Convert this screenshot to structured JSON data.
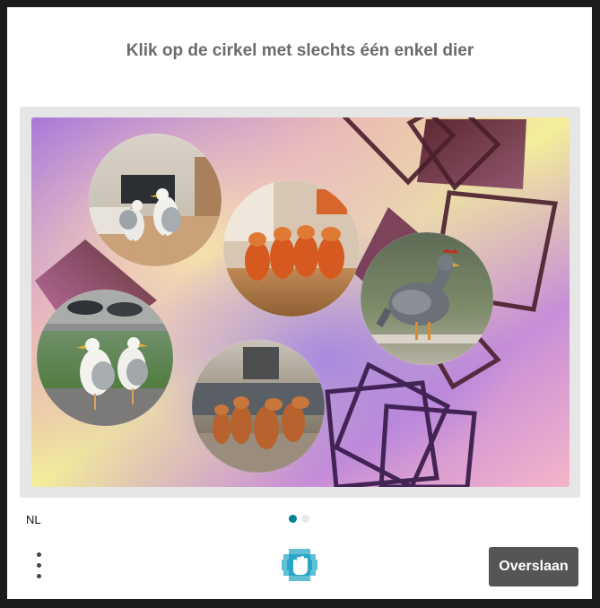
{
  "prompt": "Klik op de cirkel met slechts één enkel dier",
  "language": "NL",
  "skip_label": "Overslaan",
  "pagination": {
    "total": 2,
    "active": 1
  },
  "colors": {
    "accent": "#00838f",
    "dot_inactive": "#e8e8e8",
    "skip_button": "#555555",
    "title": "#6b6b6b"
  },
  "icons": {
    "menu": "more-vertical-icon",
    "logo": "hand-logo-icon"
  },
  "circles": [
    {
      "id": "seagulls-living-room",
      "content": "two seagulls in a living room"
    },
    {
      "id": "lizards-table",
      "content": "group of orange lizards on a table"
    },
    {
      "id": "chicken",
      "content": "single chicken on a bench"
    },
    {
      "id": "seagulls-lawn",
      "content": "two seagulls on a lawn"
    },
    {
      "id": "lizards-house",
      "content": "group of lizards in front of a house"
    }
  ]
}
